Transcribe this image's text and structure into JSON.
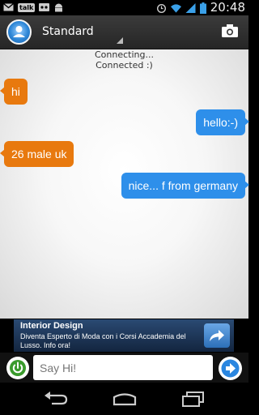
{
  "status_bar": {
    "time": "20:48",
    "talk_label": "talk",
    "left_icons": [
      "gmail-icon",
      "talk-icon",
      "voicemail-icon",
      "android-icon"
    ],
    "right_icons": [
      "alarm-icon",
      "wifi-icon",
      "signal-icon",
      "battery-icon"
    ]
  },
  "action_bar": {
    "mode": "Standard",
    "camera_icon": "camera-icon"
  },
  "chat": {
    "system_messages": [
      "Connecting...",
      "Connected :)"
    ],
    "messages": [
      {
        "from": "stranger",
        "text": "hi"
      },
      {
        "from": "me",
        "text": "hello:-)"
      },
      {
        "from": "stranger",
        "text": "26 male uk"
      },
      {
        "from": "me",
        "text": "nice... f from germany"
      }
    ],
    "colors": {
      "stranger": "#e8790e",
      "me": "#2e8fea"
    }
  },
  "ad": {
    "title": "Interior Design",
    "text": "Diventa Esperto di Moda con i Corsi Accademia del Lusso. Info ora!"
  },
  "input_bar": {
    "placeholder": "Say Hi!",
    "value": ""
  },
  "nav_bar": {
    "icons": [
      "back-icon",
      "home-icon",
      "recent-apps-icon"
    ]
  }
}
